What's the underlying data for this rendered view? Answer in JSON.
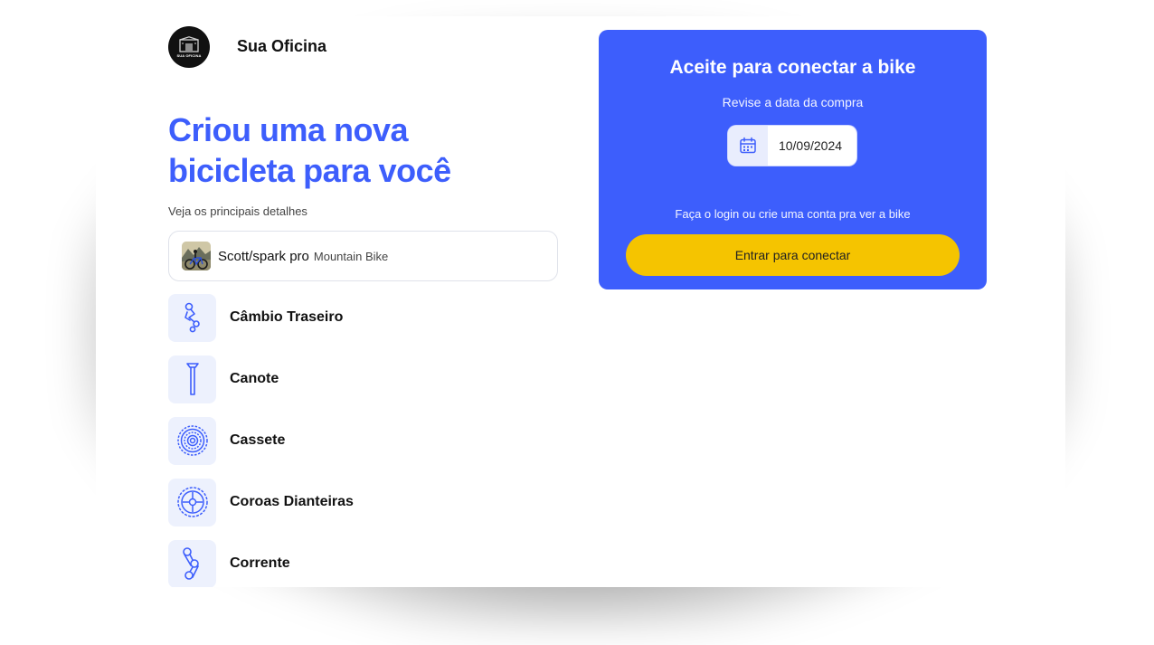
{
  "header": {
    "brand": "Sua Oficina",
    "logo_text": "SUA OFICINA"
  },
  "intro": {
    "headline_line1": "Criou uma nova",
    "headline_line2": "bicicleta para você",
    "subtitle": "Veja os principais detalhes"
  },
  "bike": {
    "name": "Scott/spark pro",
    "type": "Mountain Bike"
  },
  "components": [
    {
      "label": "Câmbio Traseiro",
      "icon": "rear-derailleur-icon"
    },
    {
      "label": "Canote",
      "icon": "seatpost-icon"
    },
    {
      "label": "Cassete",
      "icon": "cassette-icon"
    },
    {
      "label": "Coroas Dianteiras",
      "icon": "chainring-icon"
    },
    {
      "label": "Corrente",
      "icon": "chain-icon"
    }
  ],
  "panel": {
    "title": "Aceite para conectar a bike",
    "subtitle": "Revise a data da compra",
    "date_value": "10/09/2024",
    "login_text": "Faça o login ou crie uma conta pra ver a bike",
    "button_label": "Entrar para conectar"
  },
  "colors": {
    "primary": "#3d5efc",
    "accent": "#f5c400",
    "icon_bg": "#edf1fd"
  }
}
